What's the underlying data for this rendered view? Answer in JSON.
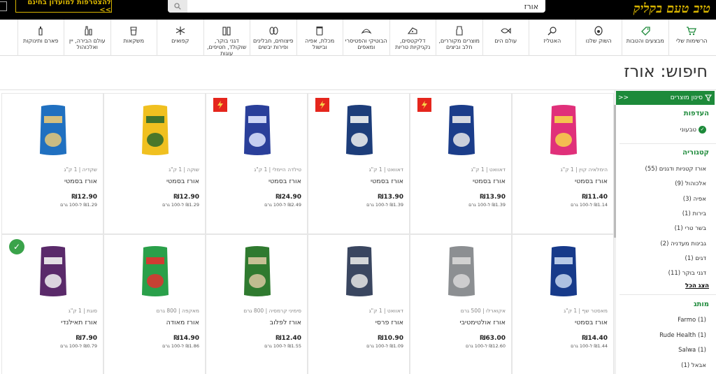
{
  "header": {
    "logo_text": "טיב טעם בקליק",
    "search_value": "אורז",
    "club_button": "להצטרפות למועדון בחינם >>"
  },
  "categories": [
    {
      "label": "הרשימות שלי",
      "icon": "cart-icon"
    },
    {
      "label": "מבצעים והטבות",
      "icon": "tag-icon"
    },
    {
      "label": "השוק שלנו",
      "icon": "avocado-icon"
    },
    {
      "label": "האטליז",
      "icon": "meat-icon"
    },
    {
      "label": "עולם הים",
      "icon": "fish-icon"
    },
    {
      "label": "מוצרים מקוררים, חלב וביצים",
      "icon": "milk-icon"
    },
    {
      "label": "דליקטסים, נקניקיות טריות",
      "icon": "cheese-icon"
    },
    {
      "label": "הבוטיקי והפטיסרי ומאפים",
      "icon": "croissant-icon"
    },
    {
      "label": "מכלת, אפיה ובישול",
      "icon": "jar-icon"
    },
    {
      "label": "פיצוחים, חבלינים ופירות יבשים",
      "icon": "peanut-icon"
    },
    {
      "label": "דגני בוקר, שוקולד, חטיפים, עוגות",
      "icon": "cereal-icon"
    },
    {
      "label": "קפואים",
      "icon": "snowflake-icon"
    },
    {
      "label": "משקאות",
      "icon": "glass-icon"
    },
    {
      "label": "עולם הבירה, יין ואלכוהול",
      "icon": "bottle-icon"
    },
    {
      "label": "פארם ותינוקות",
      "icon": "baby-bottle-icon"
    }
  ],
  "page_title": "חיפוש: אורז",
  "filters": {
    "header": "סינון מוצרים",
    "collapse": "<<",
    "preferences_title": "העדפות",
    "vegan_label": "טבעוני",
    "category_title": "קטגוריה",
    "categories": [
      "אורז קטניות ודגנים (55)",
      "אלכוהול (9)",
      "אפיה (3)",
      "בירות (1)",
      "בשר טרי (1)",
      "גבינות מעדניה (2)",
      "דגים (1)",
      "דגני בוקר (11)"
    ],
    "show_all": "הצג הכל",
    "brand_title": "מותג",
    "brands": [
      "Farmo (1)",
      "Rude Health (1)",
      "Salwa (1)",
      "אבאל (1)"
    ]
  },
  "products": [
    {
      "brand": "הימלאיה קוין | 1 ק\"ג",
      "name": "אורז בסמטי",
      "price": "₪11.40",
      "unit_price": "₪1.14 ל-100 גרם",
      "badge": "",
      "pack_color": "#e0307a",
      "pack_accent": "#f7d44a"
    },
    {
      "brand": "דאוואט | 1 ק\"ג",
      "name": "אורז בסמטי",
      "price": "₪13.90",
      "unit_price": "₪1.39 ל-100 גרם",
      "badge": "sale",
      "pack_color": "#1b3d8a",
      "pack_accent": "#e9e9e9"
    },
    {
      "brand": "דאוואט | 1 ק\"ג",
      "name": "אורז בסמטי",
      "price": "₪13.90",
      "unit_price": "₪1.39 ל-100 גרם",
      "badge": "sale",
      "pack_color": "#1d3d7a",
      "pack_accent": "#f2f2f2"
    },
    {
      "brand": "טילדה היימלי | 1 ק\"ג",
      "name": "אורז בסמטי",
      "price": "₪24.90",
      "unit_price": "₪2.49 ל-100 גרם",
      "badge": "sale",
      "pack_color": "#2a3f9a",
      "pack_accent": "#dfe6ff"
    },
    {
      "brand": "שוקה | 1 ק\"ג",
      "name": "אורז בסמטי",
      "price": "₪12.90",
      "unit_price": "₪1.29 ל-100 גרם",
      "badge": "",
      "pack_color": "#f0c020",
      "pack_accent": "#2d6a2d"
    },
    {
      "brand": "שקדיה | 1 ק\"ג",
      "name": "אורז בסמטי",
      "price": "₪12.90",
      "unit_price": "₪1.29 ל-100 גרם",
      "badge": "",
      "pack_color": "#2070c0",
      "pack_accent": "#e8c878"
    },
    {
      "brand": "מאסטר שף | 1 ק\"ג",
      "name": "אורז בסמטי",
      "price": "₪14.40",
      "unit_price": "₪1.44 ל-100 גרם",
      "badge": "",
      "pack_color": "#173a8a",
      "pack_accent": "#c8d8f0"
    },
    {
      "brand": "אקוארלו | 500 גרם",
      "name": "אורז אולטימטיבי",
      "price": "₪63.00",
      "unit_price": "₪12.60 ל-100 גרם",
      "badge": "",
      "pack_color": "#8c8f92",
      "pack_accent": "#d8d8d8"
    },
    {
      "brand": "דאוואט | 1 ק\"ג",
      "name": "אורז פרסי",
      "price": "₪10.90",
      "unit_price": "₪1.09 ל-100 גרם",
      "badge": "",
      "pack_color": "#3a4660",
      "pack_accent": "#e6e6e6"
    },
    {
      "brand": "סימיני קרמסיה | 800 גרם",
      "name": "אורז לפלוב",
      "price": "₪12.40",
      "unit_price": "₪1.55 ל-100 גרם",
      "badge": "",
      "pack_color": "#2f7a2f",
      "pack_accent": "#d8c8a0"
    },
    {
      "brand": "מאקפה | 800 גרם",
      "name": "אורז מאודה",
      "price": "₪14.90",
      "unit_price": "₪1.86 ל-100 גרם",
      "badge": "",
      "pack_color": "#2aa04a",
      "pack_accent": "#e23030"
    },
    {
      "brand": "סוגת | 1 ק\"ג",
      "name": "אורז תאילנדי",
      "price": "₪7.90",
      "unit_price": "₪0.79 ל-100 גרם",
      "badge": "vegan",
      "pack_color": "#5a2a6a",
      "pack_accent": "#f2f2f2"
    }
  ],
  "colors": {
    "brand_green": "#1d8a3a",
    "sale_red": "#e5261d",
    "logo_gold": "#d8b400"
  }
}
